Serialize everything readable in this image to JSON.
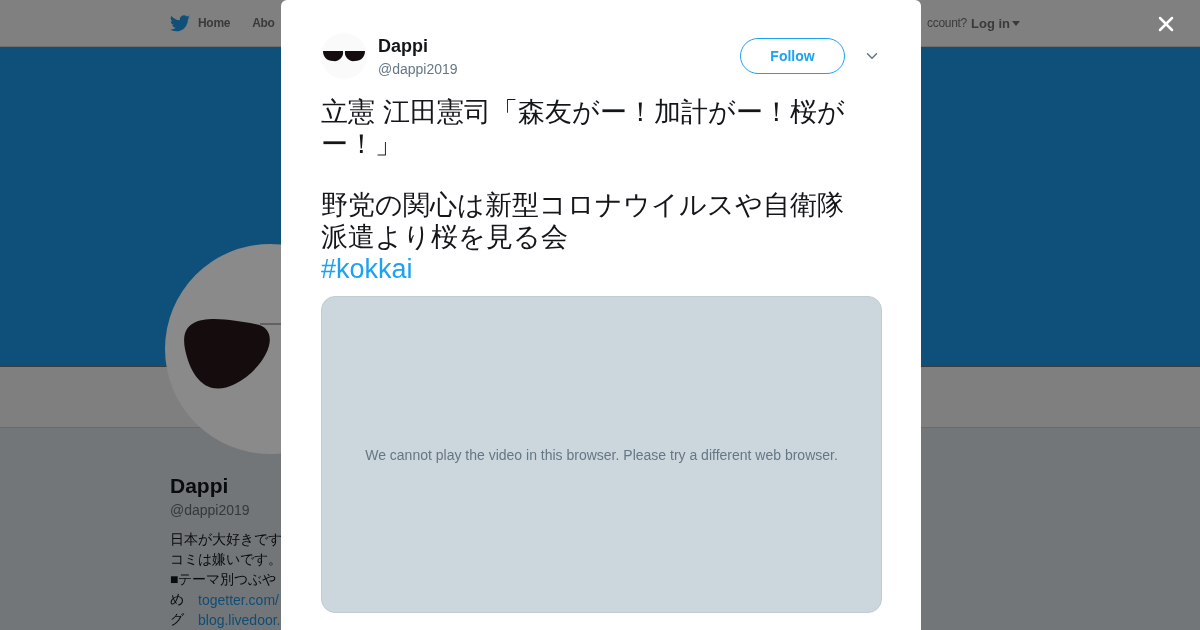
{
  "background_page": {
    "nav": {
      "home": "Home",
      "about": "Abo",
      "account_prompt": "ccount?",
      "login": "Log in"
    },
    "profile": {
      "name": "Dappi",
      "handle": "@dappi2019",
      "bio": [
        {
          "text": "日本が大好きです"
        },
        {
          "text": "コミは嫌いです。"
        },
        {
          "text": "■テーマ別つぶや"
        },
        {
          "text": "め",
          "link": "togetter.com/"
        },
        {
          "text": "グ",
          "link": "blog.livedoor."
        }
      ]
    }
  },
  "tweet_dialog": {
    "author": {
      "name": "Dappi",
      "handle": "@dappi2019"
    },
    "follow_button": "Follow",
    "paragraphs": [
      "立憲 江田憲司「森友がー！加計がー！桜がー！」",
      "野党の関心は新型コロナウイルスや自衛隊派遣より桜を見る会"
    ],
    "hashtag": "#kokkai",
    "video": {
      "message": "We cannot play the video in this browser. Please try a different web browser."
    }
  }
}
